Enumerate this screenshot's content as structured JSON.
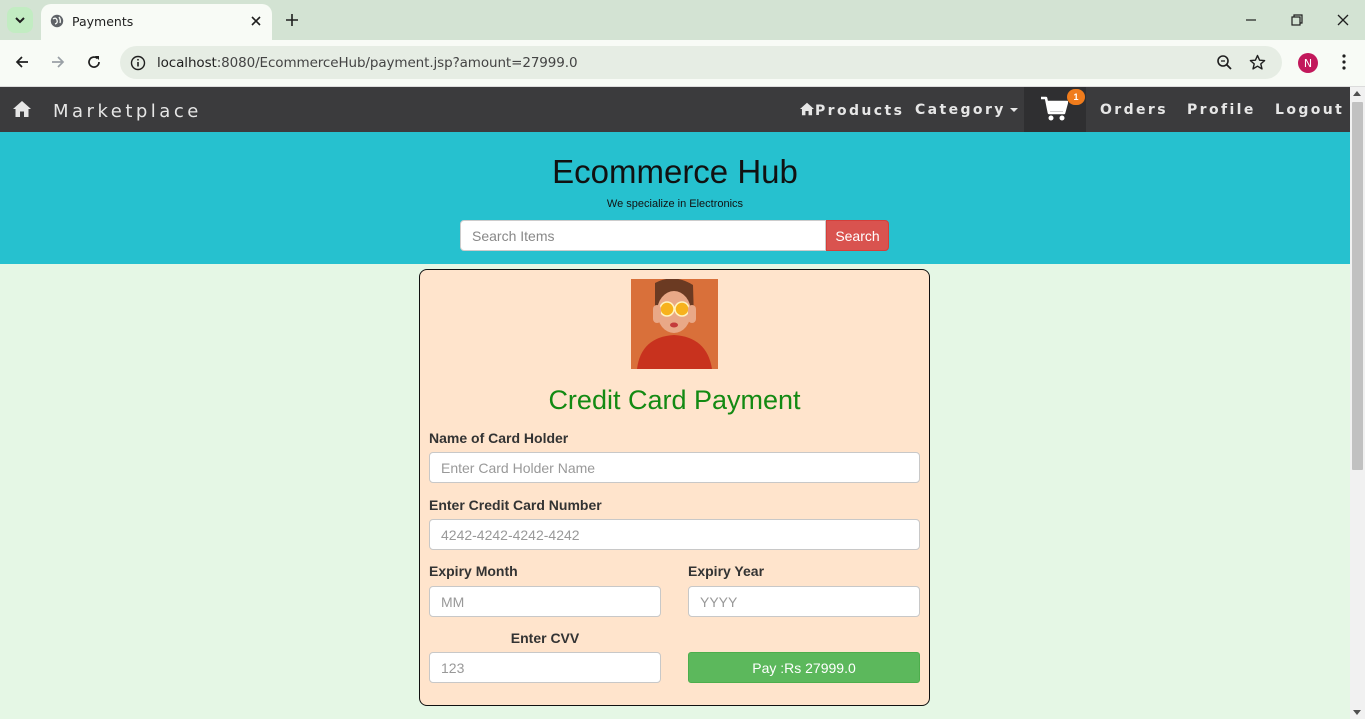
{
  "browser": {
    "tab_title": "Payments",
    "url_host": "localhost",
    "url_rest": ":8080/EcommerceHub/payment.jsp?amount=27999.0",
    "profile_initial": "N"
  },
  "navbar": {
    "brand": "Marketplace",
    "links": {
      "products": "Products",
      "category": "Category",
      "orders": "Orders",
      "profile": "Profile",
      "logout": "Logout"
    },
    "cart_count": "1",
    "cart_badge_color": "#f07c1c"
  },
  "hero": {
    "title": "Ecommerce Hub",
    "tagline": "We specialize in Electronics",
    "search_placeholder": "Search Items",
    "search_button": "Search"
  },
  "payment": {
    "heading": "Credit Card Payment",
    "holder_label": "Name of Card Holder",
    "holder_placeholder": "Enter Card Holder Name",
    "number_label": "Enter Credit Card Number",
    "number_placeholder": "4242-4242-4242-4242",
    "month_label": "Expiry Month",
    "month_placeholder": "MM",
    "year_label": "Expiry Year",
    "year_placeholder": "YYYY",
    "cvv_label": "Enter CVV",
    "cvv_placeholder": "123",
    "pay_button": "Pay :Rs 27999.0"
  },
  "colors": {
    "navbar_bg": "#3b3b3d",
    "hero_bg": "#26c1cf",
    "page_bg": "#e5f7e5",
    "card_bg": "#ffe4cc",
    "heading_green": "#138a13",
    "search_red": "#d9534f",
    "pay_green": "#5cb85c"
  }
}
